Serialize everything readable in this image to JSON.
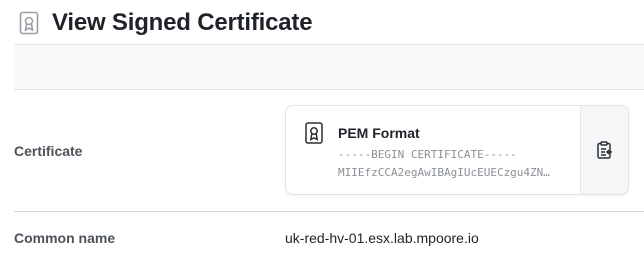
{
  "header": {
    "title": "View Signed Certificate",
    "icon": "certificate-icon"
  },
  "fields": {
    "certificate_label": "Certificate",
    "common_name_label": "Common name",
    "common_name_value": "uk-red-hv-01.esx.lab.mpoore.io"
  },
  "certificate_card": {
    "title": "PEM Format",
    "line1": "-----BEGIN CERTIFICATE-----",
    "line2": "MIIEfzCCA2egAwIBAgIUcEUECzgu4ZN…",
    "icon": "certificate-icon",
    "copy_icon": "copy-clipboard-icon"
  }
}
